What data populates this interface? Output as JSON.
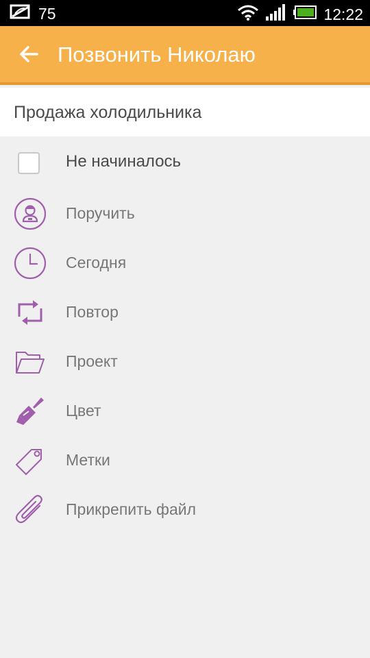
{
  "statusbar": {
    "notification_count": "75",
    "time": "12:22"
  },
  "appbar": {
    "title": "Позвонить Николаю"
  },
  "task": {
    "title": "Продажа холодильника"
  },
  "status": {
    "label": "Не начиналось"
  },
  "actions": [
    {
      "label": "Поручить",
      "icon": "assign-person-icon"
    },
    {
      "label": "Сегодня",
      "icon": "clock-icon"
    },
    {
      "label": "Повтор",
      "icon": "repeat-icon"
    },
    {
      "label": "Проект",
      "icon": "folder-icon"
    },
    {
      "label": "Цвет",
      "icon": "paint-brush-icon"
    },
    {
      "label": "Метки",
      "icon": "tag-icon"
    },
    {
      "label": "Прикрепить файл",
      "icon": "paperclip-icon"
    }
  ],
  "colors": {
    "appbar": "#f6b14a",
    "appbar_border": "#e39a35",
    "icon_accent": "#a05fab",
    "background": "#f0f0f0"
  }
}
